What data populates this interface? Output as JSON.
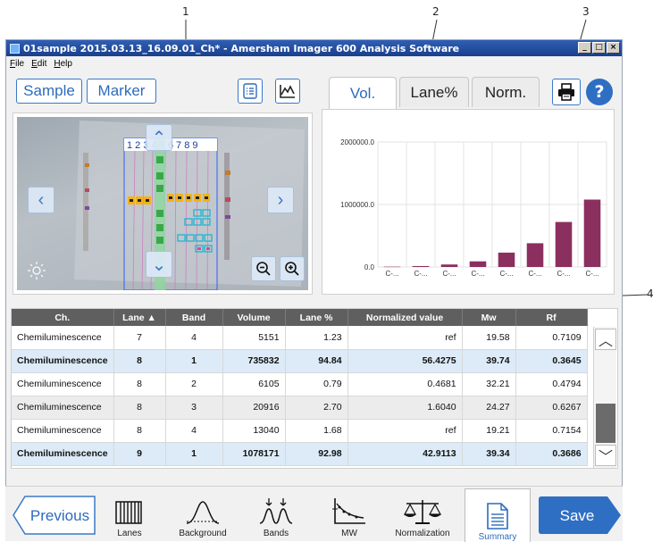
{
  "callouts": [
    "1",
    "2",
    "3",
    "4"
  ],
  "window": {
    "title": "01sample 2015.03.13_16.09.01_Ch* - Amersham Imager 600 Analysis Software",
    "controls": [
      "_",
      "□",
      "×"
    ]
  },
  "menu": [
    "File",
    "Edit",
    "Help"
  ],
  "toolbar": {
    "sample_label": "Sample",
    "marker_label": "Marker",
    "list_icon": "list-view-icon",
    "chart_icon": "chart-view-icon"
  },
  "tabs": [
    {
      "label": "Vol.",
      "active": true
    },
    {
      "label": "Lane%",
      "active": false
    },
    {
      "label": "Norm.",
      "active": false
    }
  ],
  "gel": {
    "lane_numbers": "1 2 3 4 5 6 7 8 9"
  },
  "chart_data": {
    "type": "bar",
    "y_ticks": [
      "2000000.0",
      "1000000.0",
      "0.0"
    ],
    "ylim": [
      0,
      2000000
    ],
    "categories": [
      "C-...",
      "C-...",
      "C-...",
      "C-...",
      "C-...",
      "C-...",
      "C-...",
      "C-..."
    ],
    "values": [
      5000,
      15000,
      40000,
      90000,
      230000,
      380000,
      720000,
      1078171
    ],
    "bar_color": "#8b2f5f",
    "grid": true
  },
  "table": {
    "headers": [
      "Ch.",
      "Lane ▲",
      "Band",
      "Volume",
      "Lane %",
      "Normalized value",
      "Mw",
      "Rf"
    ],
    "rows": [
      {
        "ch": "Chemiluminescence",
        "lane": "7",
        "band": "4",
        "volume": "5151",
        "lane_pct": "1.23",
        "norm": "ref",
        "mw": "19.58",
        "rf": "0.7109",
        "style": "blue"
      },
      {
        "ch": "Chemiluminescence",
        "lane": "8",
        "band": "1",
        "volume": "735832",
        "lane_pct": "94.84",
        "norm": "56.4275",
        "mw": "39.74",
        "rf": "0.3645",
        "style": "sel-blue"
      },
      {
        "ch": "Chemiluminescence",
        "lane": "8",
        "band": "2",
        "volume": "6105",
        "lane_pct": "0.79",
        "norm": "0.4681",
        "mw": "32.21",
        "rf": "0.4794",
        "style": "plain"
      },
      {
        "ch": "Chemiluminescence",
        "lane": "8",
        "band": "3",
        "volume": "20916",
        "lane_pct": "2.70",
        "norm": "1.6040",
        "mw": "24.27",
        "rf": "0.6267",
        "style": "alt"
      },
      {
        "ch": "Chemiluminescence",
        "lane": "8",
        "band": "4",
        "volume": "13040",
        "lane_pct": "1.68",
        "norm": "ref",
        "mw": "19.21",
        "rf": "0.7154",
        "style": "plain"
      },
      {
        "ch": "Chemiluminescence",
        "lane": "9",
        "band": "1",
        "volume": "1078171",
        "lane_pct": "92.98",
        "norm": "42.9113",
        "mw": "39.34",
        "rf": "0.3686",
        "style": "sel-blue"
      }
    ]
  },
  "bottom": {
    "previous_label": "Previous",
    "save_label": "Save",
    "steps": [
      {
        "label": "Lanes",
        "icon": "lanes-icon"
      },
      {
        "label": "Background",
        "icon": "background-icon"
      },
      {
        "label": "Bands",
        "icon": "bands-icon"
      },
      {
        "label": "MW",
        "icon": "mw-icon"
      },
      {
        "label": "Normalization",
        "icon": "normalization-icon"
      },
      {
        "label": "Summary",
        "icon": "summary-icon",
        "active": true
      }
    ]
  },
  "colors": {
    "accent": "#2d6bbd",
    "save_button": "#2e6fc4",
    "bar": "#8b2f5f",
    "header": "#5f5f5f",
    "selected_row": "#dcebf7"
  }
}
